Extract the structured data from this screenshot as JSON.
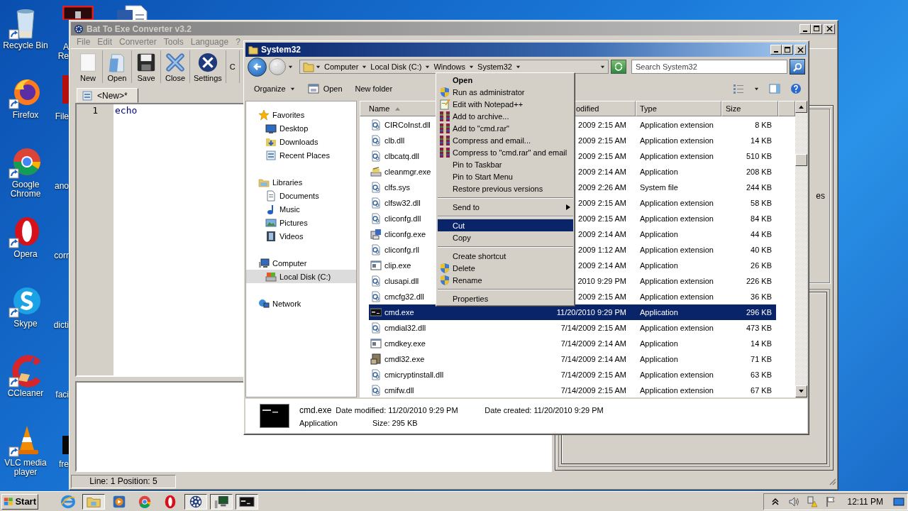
{
  "desktop": {
    "icons": [
      {
        "label": "Recycle Bin",
        "kind": "recycle"
      },
      {
        "label": "Firefox",
        "kind": "firefox"
      },
      {
        "label": "Google Chrome",
        "kind": "chrome"
      },
      {
        "label": "Opera",
        "kind": "opera"
      },
      {
        "label": "Skype",
        "kind": "skype"
      },
      {
        "label": "CCleaner",
        "kind": "ccleaner"
      },
      {
        "label": "VLC media player",
        "kind": "vlc"
      }
    ],
    "icons_column_2": [
      {
        "label": "A Re",
        "kind": "dark"
      },
      {
        "label": "File",
        "kind": "red"
      },
      {
        "label": "ano"
      },
      {
        "label": "corr"
      },
      {
        "label": "dicti"
      },
      {
        "label": "faci"
      },
      {
        "label": "fre",
        "kind": "black"
      }
    ],
    "icons_column_3": [
      {
        "kind": "document"
      }
    ]
  },
  "converter_window": {
    "title": "Bat To Exe Converter v3.2",
    "menu": [
      "File",
      "Edit",
      "Converter",
      "Tools",
      "Language",
      "?"
    ],
    "toolbar": [
      {
        "label": "New",
        "kind": "new"
      },
      {
        "label": "Open",
        "kind": "open"
      },
      {
        "label": "Save",
        "kind": "save"
      },
      {
        "label": "Close",
        "kind": "close"
      },
      {
        "label": "Settings",
        "kind": "settings"
      },
      {
        "label": "C"
      }
    ],
    "tabs": [
      {
        "label": "<New>*",
        "selected": true
      }
    ],
    "editor": {
      "lines": [
        {
          "number": "1",
          "text": "echo"
        }
      ]
    },
    "side_panel_text": "es",
    "status": "Line: 1  Position: 5"
  },
  "explorer_window": {
    "title": "System32",
    "breadcrumb": [
      "Computer",
      "Local Disk (C:)",
      "Windows",
      "System32"
    ],
    "search": {
      "placeholder": "Search System32"
    },
    "toolbar": [
      {
        "label": "Organize",
        "dropdown": true
      },
      {
        "label": "Open",
        "kind": "open"
      },
      {
        "label": "New folder"
      }
    ],
    "nav": [
      {
        "label": "Favorites",
        "kind": "star",
        "selected": false,
        "children": [
          {
            "label": "Desktop",
            "kind": "desktop",
            "selected": false
          },
          {
            "label": "Downloads",
            "kind": "downloads",
            "selected": false
          },
          {
            "label": "Recent Places",
            "kind": "recent",
            "selected": false
          }
        ]
      },
      {
        "label": "Libraries",
        "kind": "library",
        "selected": false,
        "children": [
          {
            "label": "Documents",
            "kind": "documents",
            "selected": false
          },
          {
            "label": "Music",
            "kind": "music",
            "selected": false
          },
          {
            "label": "Pictures",
            "kind": "pictures",
            "selected": false
          },
          {
            "label": "Videos",
            "kind": "videos",
            "selected": false
          }
        ]
      },
      {
        "label": "Computer",
        "kind": "computer",
        "selected": false,
        "children": [
          {
            "label": "Local Disk (C:)",
            "kind": "disk",
            "selected": true
          }
        ]
      },
      {
        "label": "Network",
        "kind": "network",
        "selected": false
      }
    ],
    "table": {
      "columns": [
        "Name",
        "odified",
        "Type",
        "Size"
      ],
      "rows": [
        {
          "name": "CIRCoInst.dll",
          "date": "2009 2:15 AM",
          "type": "Application extension",
          "size": "8 KB",
          "kind": "dll",
          "selected": false
        },
        {
          "name": "clb.dll",
          "date": "2009 2:15 AM",
          "type": "Application extension",
          "size": "14 KB",
          "kind": "dll",
          "selected": false
        },
        {
          "name": "clbcatq.dll",
          "date": "2009 2:15 AM",
          "type": "Application extension",
          "size": "510 KB",
          "kind": "dll",
          "selected": false
        },
        {
          "name": "cleanmgr.exe",
          "date": "2009 2:14 AM",
          "type": "Application",
          "size": "208 KB",
          "kind": "cleanup",
          "selected": false
        },
        {
          "name": "clfs.sys",
          "date": "2009 2:26 AM",
          "type": "System file",
          "size": "244 KB",
          "kind": "dll",
          "selected": false
        },
        {
          "name": "clfsw32.dll",
          "date": "2009 2:15 AM",
          "type": "Application extension",
          "size": "58 KB",
          "kind": "dll",
          "selected": false
        },
        {
          "name": "cliconfg.dll",
          "date": "2009 2:15 AM",
          "type": "Application extension",
          "size": "84 KB",
          "kind": "dll",
          "selected": false
        },
        {
          "name": "cliconfg.exe",
          "date": "2009 2:14 AM",
          "type": "Application",
          "size": "44 KB",
          "kind": "netapp",
          "selected": false
        },
        {
          "name": "cliconfg.rll",
          "date": "2009 1:12 AM",
          "type": "Application extension",
          "size": "40 KB",
          "kind": "dll",
          "selected": false
        },
        {
          "name": "clip.exe",
          "date": "2009 2:14 AM",
          "type": "Application",
          "size": "26 KB",
          "kind": "window",
          "selected": false
        },
        {
          "name": "clusapi.dll",
          "date": "2010 9:29 PM",
          "type": "Application extension",
          "size": "226 KB",
          "kind": "dll",
          "selected": false
        },
        {
          "name": "cmcfg32.dll",
          "date": "2009 2:15 AM",
          "type": "Application extension",
          "size": "36 KB",
          "kind": "dll",
          "selected": false
        },
        {
          "name": "cmd.exe",
          "date": "11/20/2010 9:29 PM",
          "type": "Application",
          "size": "296 KB",
          "kind": "cmd",
          "selected": true
        },
        {
          "name": "cmdial32.dll",
          "date": "7/14/2009 2:15 AM",
          "type": "Application extension",
          "size": "473 KB",
          "kind": "dll",
          "selected": false
        },
        {
          "name": "cmdkey.exe",
          "date": "7/14/2009 2:14 AM",
          "type": "Application",
          "size": "14 KB",
          "kind": "window",
          "selected": false
        },
        {
          "name": "cmdl32.exe",
          "date": "7/14/2009 2:14 AM",
          "type": "Application",
          "size": "71 KB",
          "kind": "installer",
          "selected": false
        },
        {
          "name": "cmicryptinstall.dll",
          "date": "7/14/2009 2:15 AM",
          "type": "Application extension",
          "size": "63 KB",
          "kind": "dll",
          "selected": false
        },
        {
          "name": "cmifw.dll",
          "date": "7/14/2009 2:15 AM",
          "type": "Application extension",
          "size": "67 KB",
          "kind": "dll",
          "selected": false
        }
      ]
    },
    "details": {
      "name": "cmd.exe",
      "date_modified": "Date modified: 11/20/2010 9:29 PM",
      "date_created": "Date created: 11/20/2010 9:29 PM",
      "type": "Application",
      "size": "Size: 295 KB"
    }
  },
  "context_menu": {
    "items": [
      {
        "kind": "plain",
        "label": "Open",
        "default": true,
        "selected": false
      },
      {
        "kind": "shield",
        "label": "Run as administrator",
        "selected": false
      },
      {
        "kind": "notepad",
        "label": "Edit with Notepad++",
        "selected": false
      },
      {
        "kind": "archive",
        "label": "Add to archive...",
        "selected": false
      },
      {
        "kind": "archive",
        "label": "Add to \"cmd.rar\"",
        "selected": false
      },
      {
        "kind": "archive",
        "label": "Compress and email...",
        "selected": false
      },
      {
        "kind": "archive",
        "label": "Compress to \"cmd.rar\" and email",
        "selected": false
      },
      {
        "kind": "plain",
        "label": "Pin to Taskbar",
        "selected": false
      },
      {
        "kind": "plain",
        "label": "Pin to Start Menu",
        "selected": false
      },
      {
        "kind": "plain",
        "label": "Restore previous versions",
        "selected": false
      },
      {
        "kind": "separator"
      },
      {
        "kind": "plain",
        "label": "Send to",
        "submenu": true,
        "selected": false
      },
      {
        "kind": "separator"
      },
      {
        "kind": "plain",
        "label": "Cut",
        "selected": true
      },
      {
        "kind": "plain",
        "label": "Copy",
        "selected": false
      },
      {
        "kind": "separator"
      },
      {
        "kind": "plain",
        "label": "Create shortcut",
        "selected": false
      },
      {
        "kind": "shield",
        "label": "Delete",
        "selected": false
      },
      {
        "kind": "shield",
        "label": "Rename",
        "selected": false
      },
      {
        "kind": "separator"
      },
      {
        "kind": "plain",
        "label": "Properties",
        "selected": false
      }
    ]
  },
  "taskbar": {
    "start": "Start",
    "items": [
      {
        "kind": "ie",
        "selected": false
      },
      {
        "kind": "explorer",
        "selected": true
      },
      {
        "kind": "media",
        "selected": false
      },
      {
        "kind": "chrome",
        "selected": false
      },
      {
        "kind": "opera",
        "selected": false
      },
      {
        "kind": "gear",
        "selected": true
      },
      {
        "kind": "network-app",
        "selected": true
      },
      {
        "kind": "cmd",
        "selected": true
      }
    ],
    "clock": "12:11 PM"
  }
}
